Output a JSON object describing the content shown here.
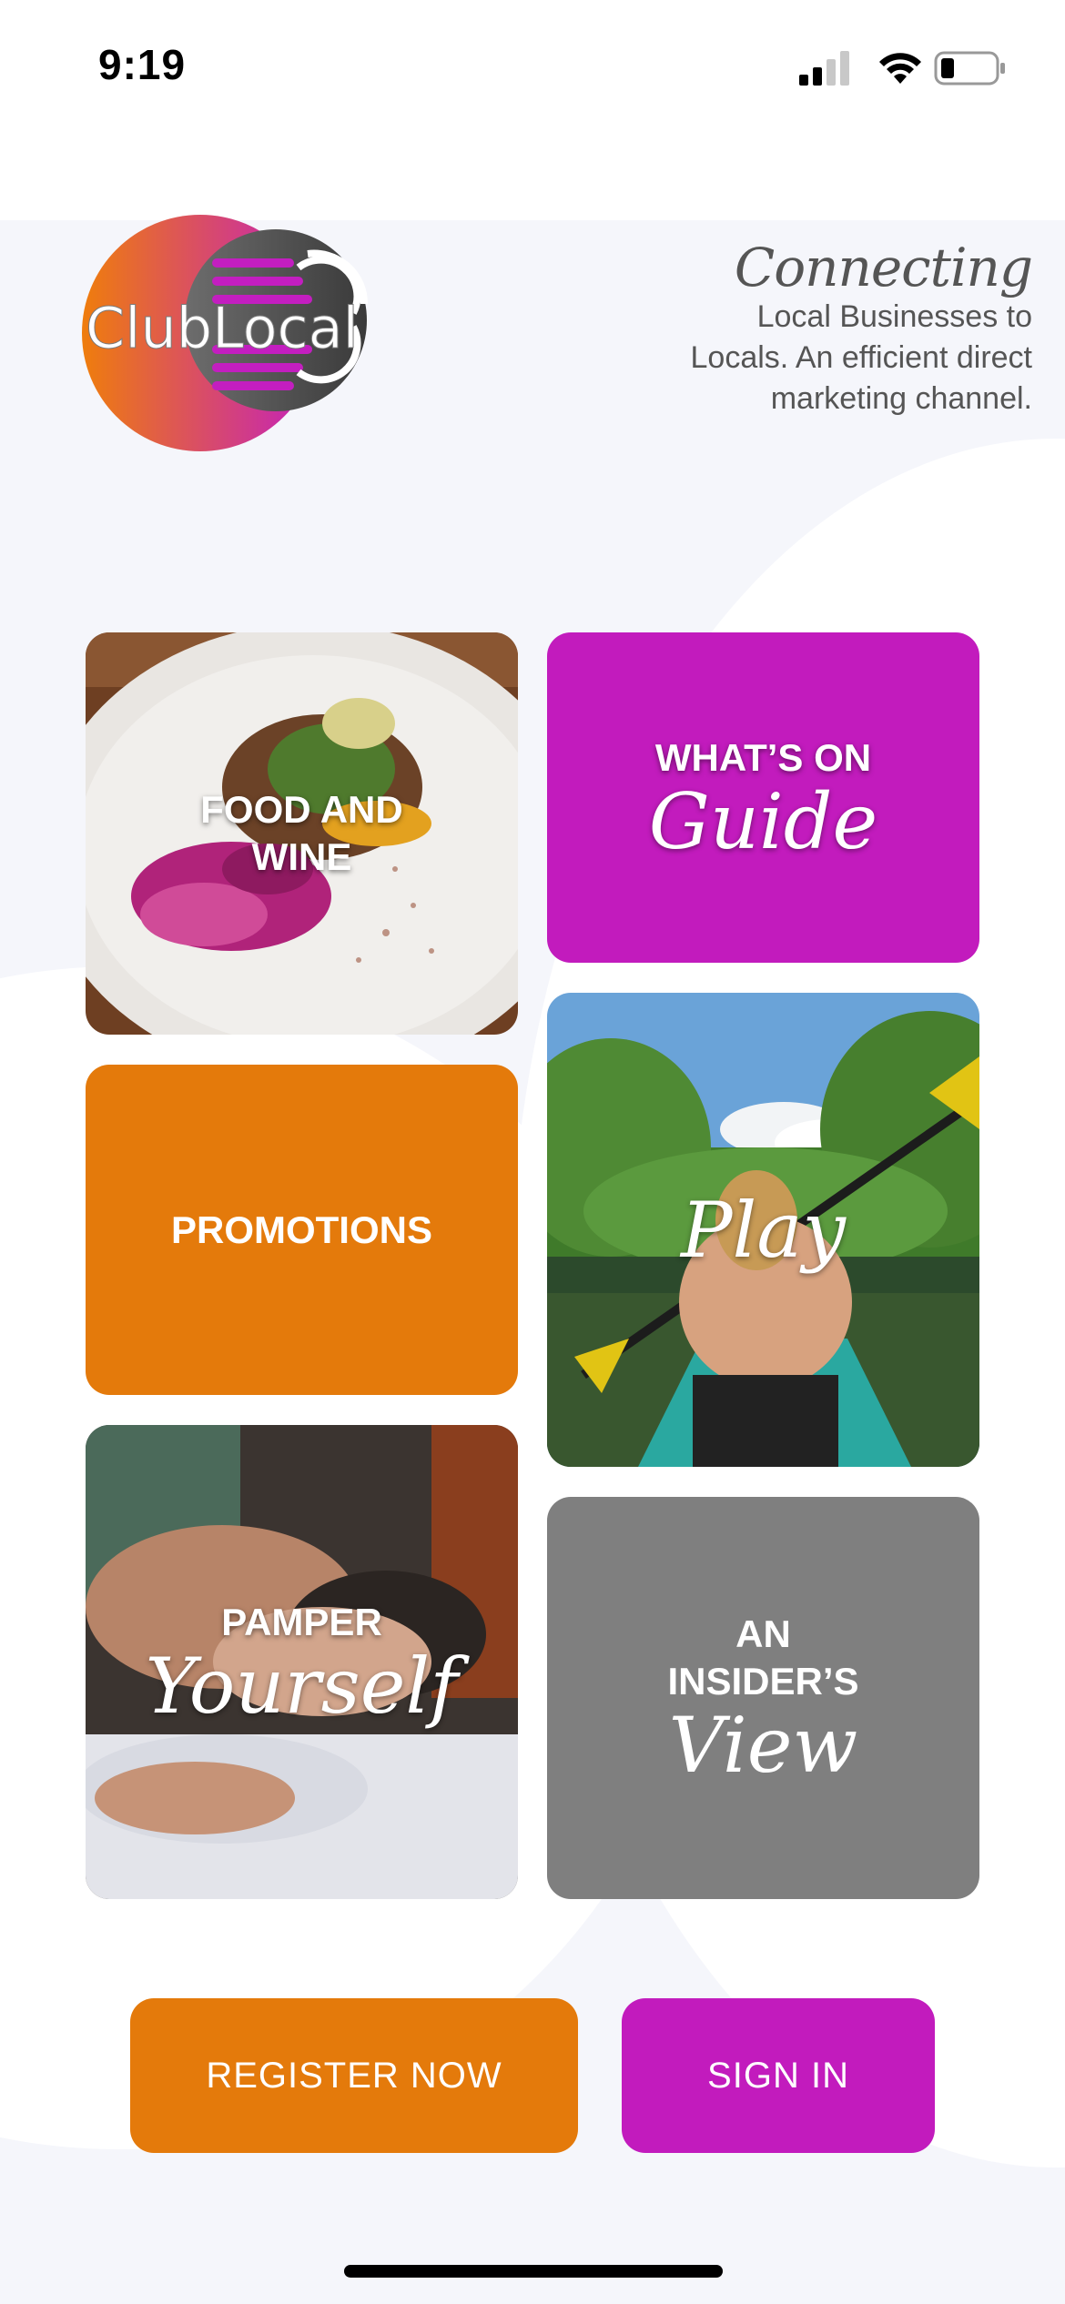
{
  "status_bar": {
    "time": "9:19",
    "icons": [
      "signal-icon",
      "wifi-icon",
      "battery-icon"
    ]
  },
  "header": {
    "logo_text": "ClubLocal",
    "tagline_script": "Connecting",
    "tagline_lines": [
      "Local Businesses to",
      "Locals. An efficient direct",
      "marketing channel."
    ]
  },
  "tiles": {
    "food": {
      "line1": "FOOD AND",
      "line2": "WINE"
    },
    "whatson": {
      "caption": "WHAT’S ON",
      "script": "Guide"
    },
    "promotions": {
      "caption": "PROMOTIONS"
    },
    "play": {
      "script": "Play"
    },
    "pamper": {
      "caption": "PAMPER",
      "script": "Yourself"
    },
    "insider": {
      "line1": "AN",
      "line2": "INSIDER’S",
      "script": "View"
    }
  },
  "buttons": {
    "register": "REGISTER NOW",
    "signin": "SIGN IN"
  },
  "colors": {
    "magenta": "#c21bbd",
    "orange": "#e47a0b",
    "gray": "#7f7f7f",
    "background": "#f5f6fb"
  }
}
